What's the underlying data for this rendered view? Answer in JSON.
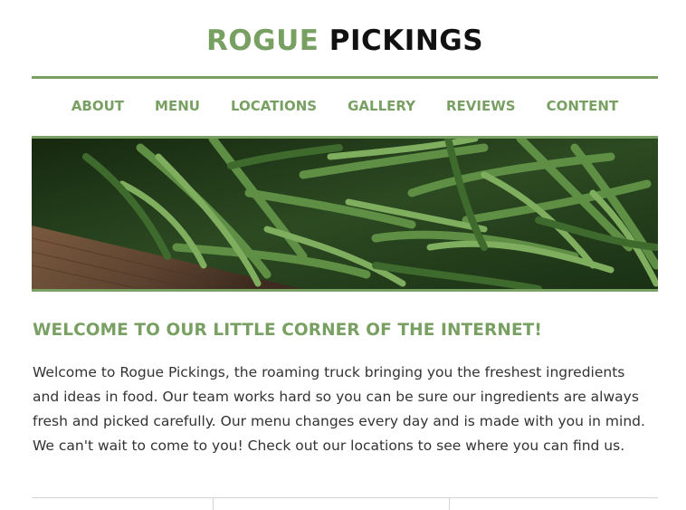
{
  "header": {
    "brand_accent": "ROGUE",
    "brand_rest": "PICKINGS"
  },
  "nav": {
    "items": [
      {
        "label": "ABOUT"
      },
      {
        "label": "MENU"
      },
      {
        "label": "LOCATIONS"
      },
      {
        "label": "GALLERY"
      },
      {
        "label": "REVIEWS"
      },
      {
        "label": "CONTENT"
      }
    ]
  },
  "hero": {
    "image_subject": "green beans in a wooden crate"
  },
  "main": {
    "heading": "WELCOME TO OUR LITTLE CORNER OF THE INTERNET!",
    "body": "Welcome to Rogue Pickings, the roaming truck bringing you the freshest ingredients and ideas in food. Our team works hard so you can be sure our ingredients are always fresh and picked carefully. Our menu changes every day and is made with you in mind. We can't wait to come to you! Check out our locations to see where you can find us."
  },
  "colors": {
    "accent": "#79a063",
    "text": "#333333",
    "brand_dark": "#111111"
  }
}
